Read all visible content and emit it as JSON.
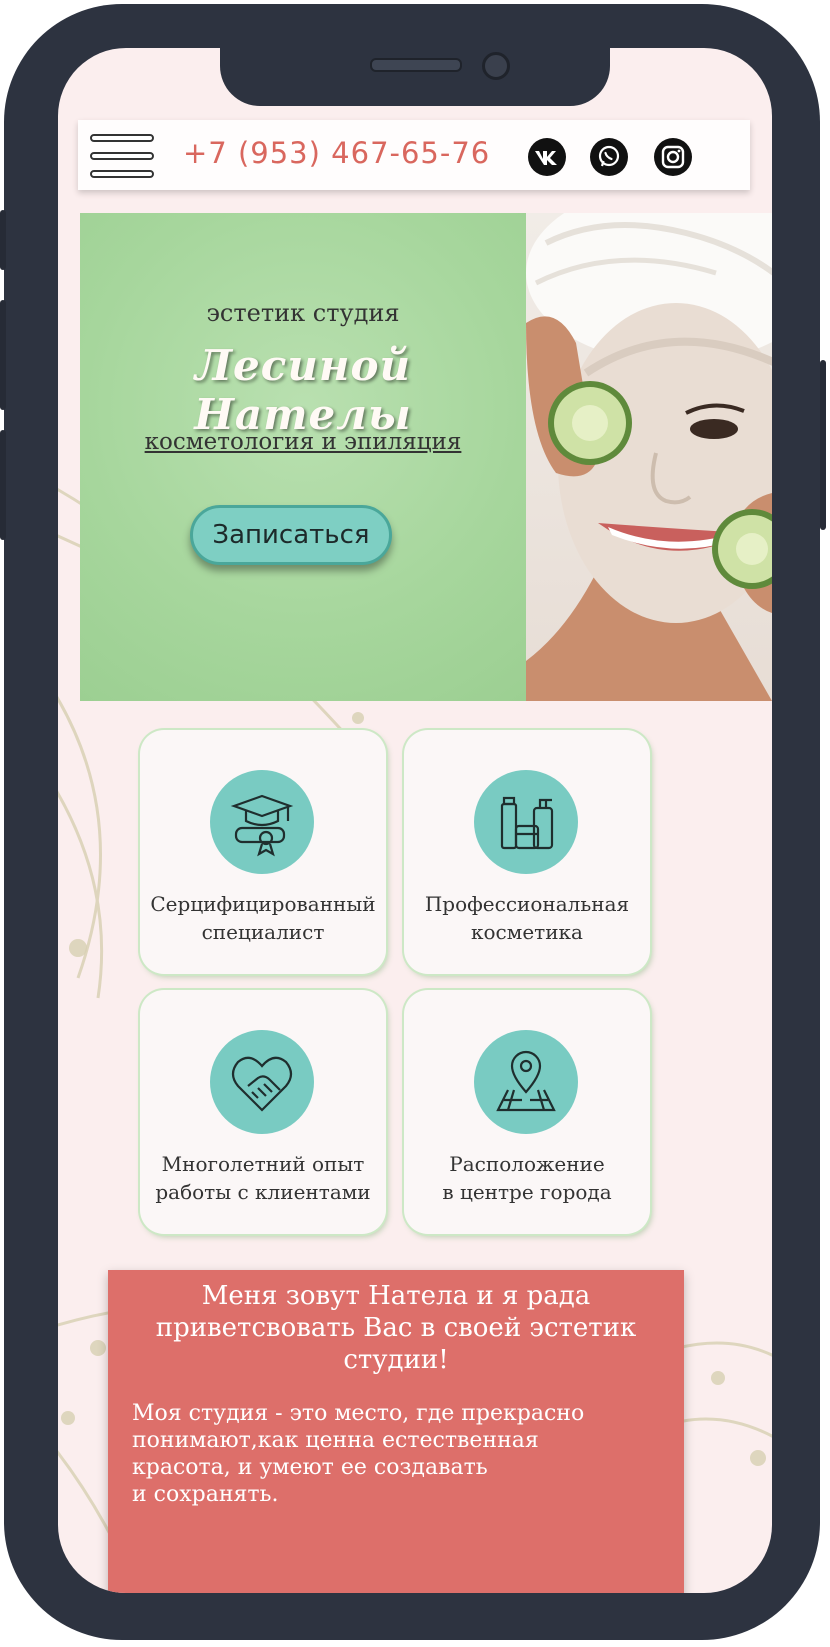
{
  "header": {
    "phone": "+7 (953) 467-65-76",
    "social": [
      {
        "name": "vk-icon",
        "label": "vk"
      },
      {
        "name": "whatsapp-icon",
        "label": "whatsapp"
      },
      {
        "name": "instagram-icon",
        "label": "instagram"
      }
    ]
  },
  "hero": {
    "subtitle": "эстетик студия",
    "name": "Лесиной Нателы",
    "tagline": "косметология и эпиляция",
    "cta_label": "Записаться"
  },
  "features": [
    {
      "icon": "graduation-diploma-icon",
      "line1": "Серцифицированный",
      "line2": "специалист"
    },
    {
      "icon": "cosmetics-bottles-icon",
      "line1": "Профессиональная",
      "line2": "косметика"
    },
    {
      "icon": "handshake-heart-icon",
      "line1": "Многолетний опыт",
      "line2": "работы с клиентами"
    },
    {
      "icon": "map-pin-icon",
      "line1": "Расположение",
      "line2": "в центре города"
    }
  ],
  "about": {
    "title_line1": "Меня зовут Натела и я рада",
    "title_line2": "приветсвовать Вас в своей эстетик",
    "title_line3": "студии!",
    "body_line1": "Моя студия - это место, где прекрасно",
    "body_line2": "понимают,как ценна естественная",
    "body_line3": "красота, и умеют ее создавать",
    "body_line4": "и сохранять."
  },
  "colors": {
    "frame": "#2d3340",
    "page_bg": "#fbeeee",
    "accent_phone": "#d9675e",
    "hero_green": "#a6d69c",
    "teal": "#79cbc2",
    "about_red": "#dd6f6a"
  }
}
